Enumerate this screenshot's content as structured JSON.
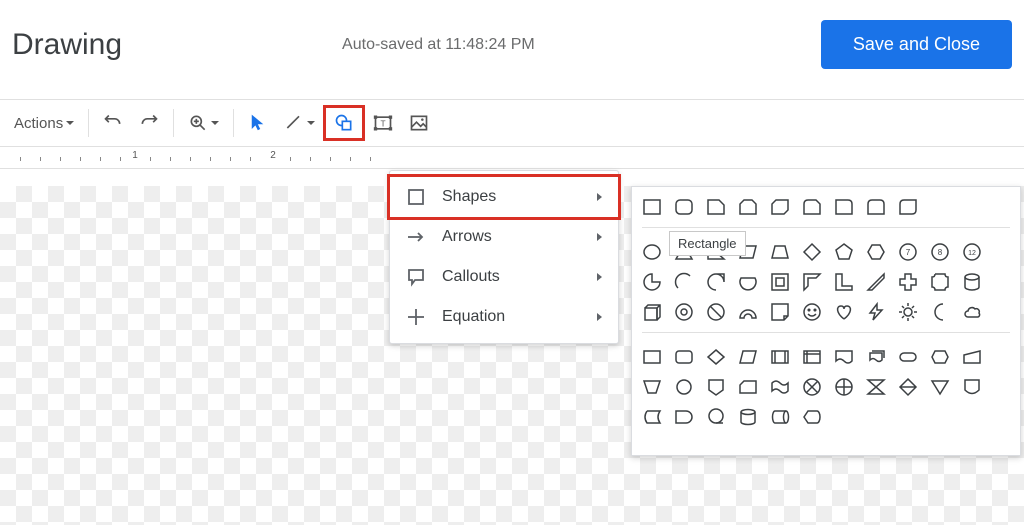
{
  "header": {
    "title": "Drawing",
    "autosave": "Auto-saved at 11:48:24 PM",
    "save_label": "Save and Close"
  },
  "toolbar": {
    "actions_label": "Actions"
  },
  "ruler": {
    "n1": "1",
    "n2": "2"
  },
  "menu": {
    "shapes": "Shapes",
    "arrows": "Arrows",
    "callouts": "Callouts",
    "equation": "Equation"
  },
  "shapes": {
    "tooltip": "Rectangle",
    "badge7": "7",
    "badge8": "8",
    "badge12": "12"
  }
}
